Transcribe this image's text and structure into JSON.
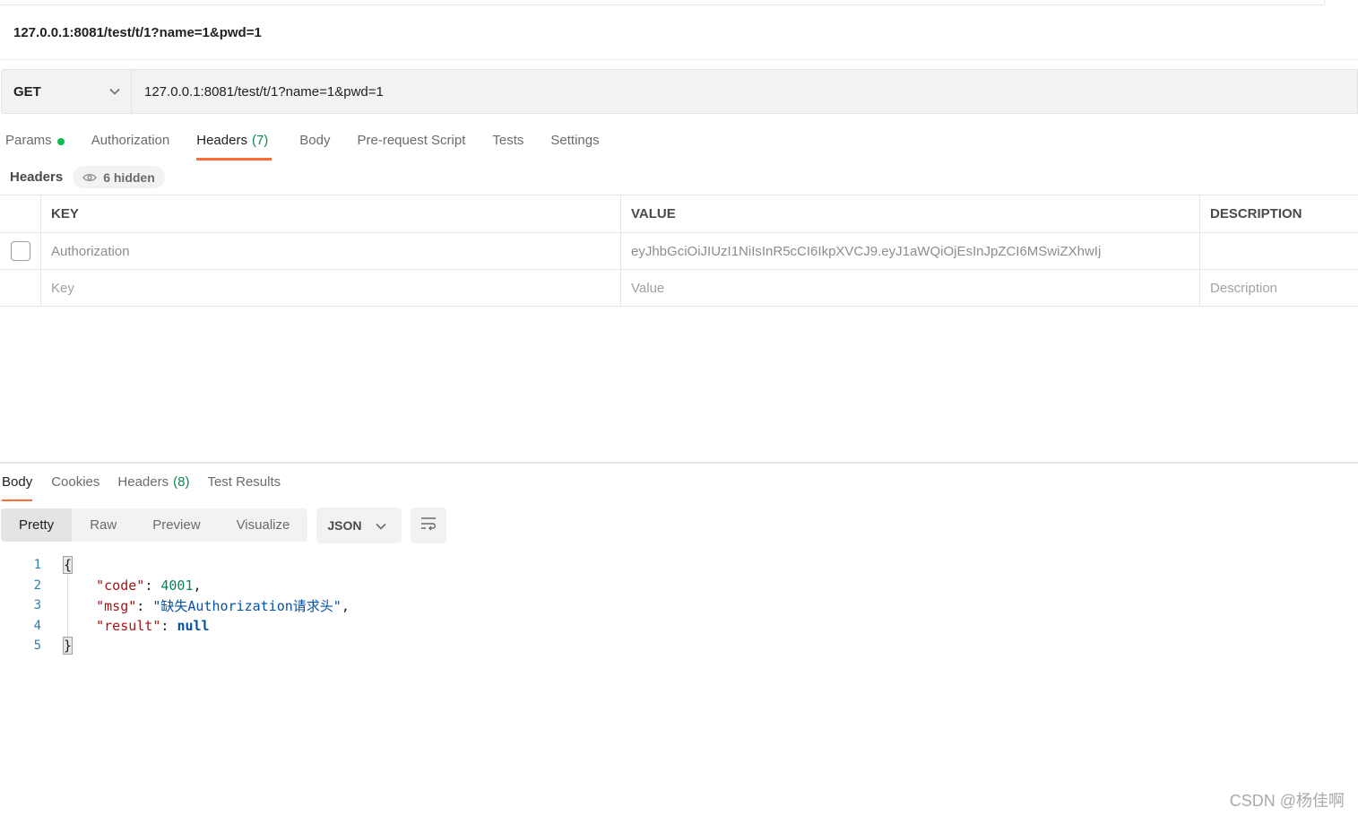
{
  "request": {
    "title": "127.0.0.1:8081/test/t/1?name=1&pwd=1",
    "method": "GET",
    "url": "127.0.0.1:8081/test/t/1?name=1&pwd=1"
  },
  "request_tabs": [
    {
      "label": "Params",
      "indicator": true
    },
    {
      "label": "Authorization"
    },
    {
      "label": "Headers",
      "count": "(7)",
      "active": true
    },
    {
      "label": "Body"
    },
    {
      "label": "Pre-request Script"
    },
    {
      "label": "Tests"
    },
    {
      "label": "Settings"
    }
  ],
  "headers_section": {
    "label": "Headers",
    "hidden_label": "6 hidden"
  },
  "headers_table": {
    "columns": [
      "KEY",
      "VALUE",
      "DESCRIPTION"
    ],
    "rows": [
      {
        "checked": false,
        "key": "Authorization",
        "value": "eyJhbGciOiJIUzI1NiIsInR5cCI6IkpXVCJ9.eyJ1aWQiOjEsInJpZCI6MSwiZXhwIj",
        "description": ""
      }
    ],
    "placeholders": {
      "key": "Key",
      "value": "Value",
      "description": "Description"
    }
  },
  "response_tabs": [
    {
      "label": "Body",
      "active": true
    },
    {
      "label": "Cookies"
    },
    {
      "label": "Headers",
      "count": "(8)"
    },
    {
      "label": "Test Results"
    }
  ],
  "format_modes": [
    "Pretty",
    "Raw",
    "Preview",
    "Visualize"
  ],
  "format_active": "Pretty",
  "format_type": "JSON",
  "response_body": {
    "line_numbers": [
      "1",
      "2",
      "3",
      "4",
      "5"
    ],
    "open_brace": "{",
    "close_brace": "}",
    "fields": [
      {
        "key": "\"code\"",
        "value": "4001",
        "kind": "number",
        "comma": ","
      },
      {
        "key": "\"msg\"",
        "value": "\"缺失Authorization请求头\"",
        "kind": "string",
        "comma": ","
      },
      {
        "key": "\"result\"",
        "value": "null",
        "kind": "keyword",
        "comma": ""
      }
    ]
  },
  "watermark": "CSDN @杨佳啊",
  "colors": {
    "accent_tab_underline": "#ff6c37",
    "params_dot": "#0cbb52",
    "count_text": "#0c8a4d"
  },
  "icons": {
    "method_dropdown": "chevron-down-icon",
    "hidden_headers": "eye-icon",
    "format_dropdown": "chevron-down-icon",
    "wrap": "wrap-lines-icon"
  }
}
